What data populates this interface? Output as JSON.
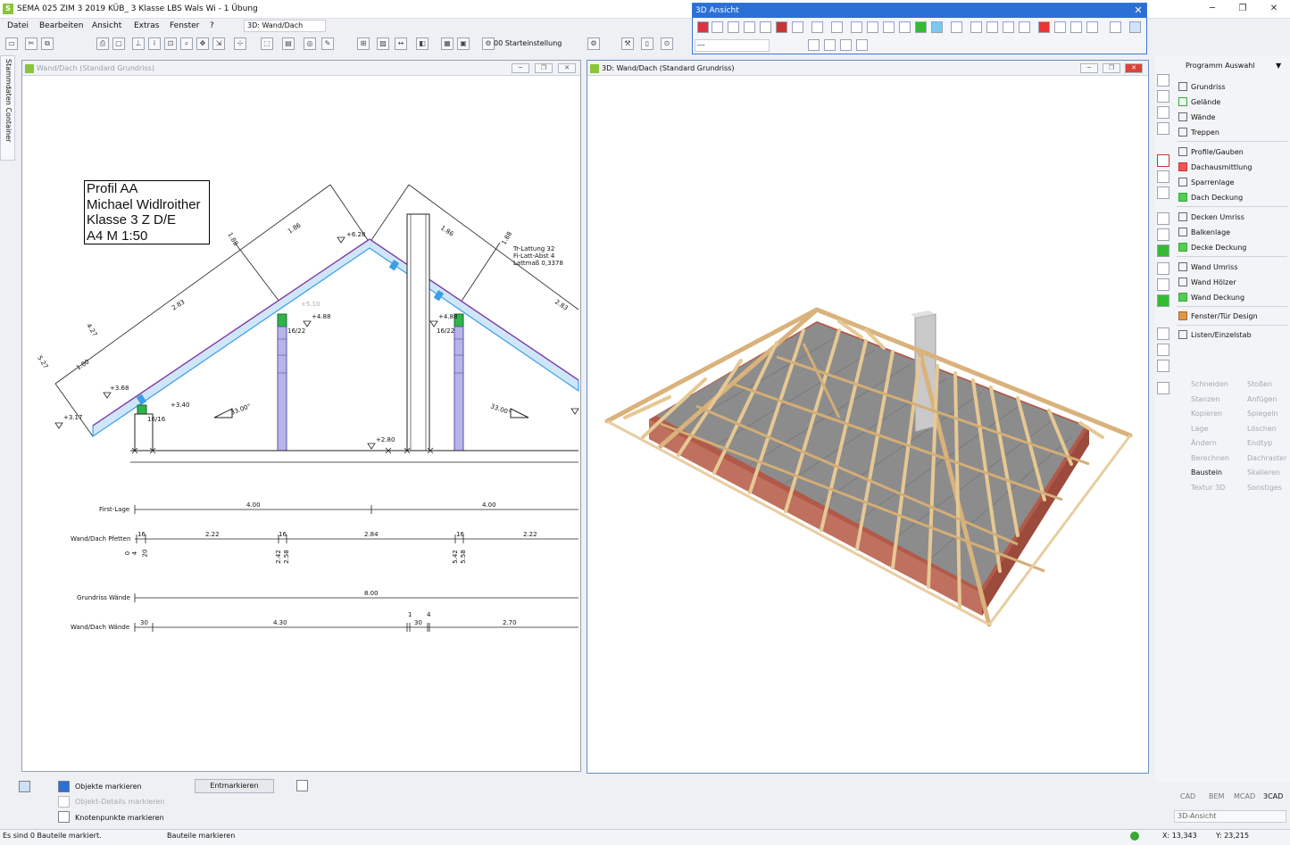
{
  "app": {
    "icon_letter": "S",
    "title": "SEMA  025 ZIM 3 2019 KÜB_ 3 Klasse LBS Wals Wi - 1 Übung",
    "win_min": "─",
    "win_max": "❐",
    "win_close": "✕"
  },
  "menu": {
    "items": [
      "Datei",
      "Bearbeiten",
      "Ansicht",
      "Extras",
      "Fenster",
      "?"
    ],
    "view_select": "3D: Wand/Dach",
    "start_select": "00 Starteinstellung"
  },
  "ansicht_toolbar": {
    "title": "3D Ansicht",
    "close": "✕",
    "input_value": "---"
  },
  "sidebar_tab": {
    "label": "Stammdaten Container"
  },
  "window_2d": {
    "title": "Wand/Dach (Standard Grundriss)",
    "drawing": {
      "title_block": [
        "Profil AA",
        "Michael Widlroither",
        "Klasse 3 Z D/E",
        "A4  M 1:50"
      ],
      "elevations": [
        "+6.28",
        "+5.10",
        "+4.88",
        "+4.88",
        "+3.68",
        "+3.40",
        "+3.17",
        "+2.80"
      ],
      "member_labels": [
        "16/22",
        "16/22",
        "16/16"
      ],
      "lengths": [
        "1.86",
        "1.86",
        "1.88",
        "1.88",
        "2.83",
        "2.83",
        "1.00",
        "4.27",
        "5.27"
      ],
      "angles": [
        "33.00°",
        "33.00°"
      ],
      "lattung": [
        "Tr-Lattung   32",
        "Fi-Latt-Abst  4",
        "Lattmaß       0,3378"
      ],
      "dim_rows": [
        {
          "label": "First-Lage",
          "values": [
            "4.00",
            "4.00"
          ]
        },
        {
          "label": "Wand/Dach Pfetten",
          "values": [
            "16",
            "2.22",
            "16",
            "2.84",
            "16",
            "2.22"
          ],
          "subvalues": [
            "0",
            "4",
            "20",
            "2.42",
            "2.58",
            "5.42",
            "5.58"
          ]
        },
        {
          "label": "Grundriss Wände",
          "values": [
            "8.00"
          ]
        },
        {
          "label": "Wand/Dach Wände",
          "values": [
            "30",
            "4.30",
            "1",
            "4",
            "30",
            "2.70"
          ]
        }
      ]
    }
  },
  "window_3d": {
    "title": "3D: Wand/Dach (Standard Grundriss)"
  },
  "right_panel": {
    "program_label": "Programm Auswahl",
    "groups": [
      [
        "Grundriss",
        "Gelände",
        "Wände",
        "Treppen"
      ],
      [
        "Profile/Gauben",
        "Dachausmittlung",
        "Sparrenlage",
        "Dach Deckung"
      ],
      [
        "Decken Umriss",
        "Balkenlage",
        "Decke Deckung"
      ],
      [
        "Wand Umriss",
        "Wand Hölzer",
        "Wand Deckung"
      ],
      [
        "Fenster/Tür Design"
      ],
      [
        "Listen/Einzelstab"
      ]
    ],
    "tools_left": [
      "Schneiden",
      "Stanzen",
      "Kopieren",
      "Lage",
      "Ändern",
      "Berechnen",
      "Baustein",
      "Textur 3D"
    ],
    "tools_right": [
      "Stoßen",
      "Anfügen",
      "Spiegeln",
      "Löschen",
      "Endtyp",
      "Dachraster",
      "Skalieren",
      "Sonstiges"
    ]
  },
  "bottom": {
    "objects_mark": "Objekte markieren",
    "object_details": "Objekt-Details markieren",
    "nodes_mark": "Knotenpunkte markieren",
    "unmark_button": "Entmarkieren",
    "modes": [
      "CAD",
      "BEM",
      "MCAD",
      "3CAD"
    ],
    "ansicht_select": "3D-Ansicht"
  },
  "status": {
    "left": "Es sind 0 Bauteile markiert.",
    "mid": "Bauteile markieren",
    "x": "X: 13,343",
    "y": "Y: 23,215"
  },
  "colors": {
    "accent": "#2c6fd6",
    "app_green": "#8ac53b",
    "roof_blue": "#3a9ee8",
    "roof_purple": "#8a2aa0",
    "purlin_green": "#2fb34a",
    "timber": "#e8c896",
    "brick": "#b25a4a"
  }
}
